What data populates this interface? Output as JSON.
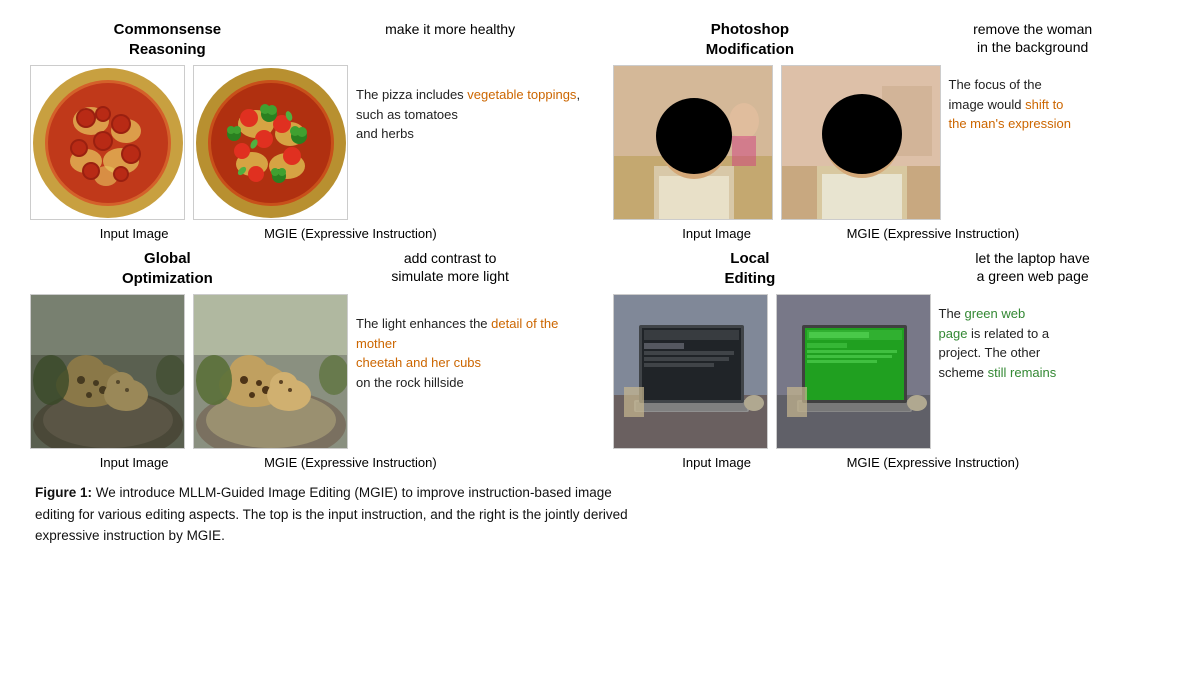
{
  "panels": {
    "top_left": {
      "title": "Commonsense\nReasoning",
      "instruction": "make it more healthy",
      "description": "The pizza includes ",
      "desc_highlight": "vegetable toppings",
      "desc_rest": ",\nsuch as tomatoes\nand herbs",
      "img1_label": "Input Image",
      "img2_label": "MGIE (Expressive Instruction)"
    },
    "top_right": {
      "title": "Photoshop\nModification",
      "instruction": "remove the woman\nin the background",
      "desc_before": "The focus of the\nimage would ",
      "desc_highlight": "shift to\nthe man's expression",
      "img1_label": "Input Image",
      "img2_label": "MGIE (Expressive Instruction)"
    },
    "bottom_left": {
      "title": "Global\nOptimization",
      "instruction": "add contrast to\nsimulate more light",
      "desc_before": "The light enhances the ",
      "desc_highlight": "detail of the mother\ncheetah and her cubs",
      "desc_rest": "\non the rock hillside",
      "img1_label": "Input Image",
      "img2_label": "MGIE (Expressive Instruction)"
    },
    "bottom_right": {
      "title": "Local\nEditing",
      "instruction": "let the laptop have\na green web page",
      "desc_before": "The ",
      "desc_highlight1": "green web\npage",
      "desc_mid": " is related to a\nproject. The other\nscheme ",
      "desc_highlight2": "still remains",
      "img1_label": "Input Image",
      "img2_label": "MGIE (Expressive Instruction)"
    }
  },
  "caption": {
    "bold_part": "Figure 1:",
    "text": " We introduce MLLM-Guided Image Editing (MGIE) to improve instruction-based image\nediting for various editing aspects. The top is the input instruction, and the right is the jointly derived\nexpressive instruction by MGIE."
  }
}
